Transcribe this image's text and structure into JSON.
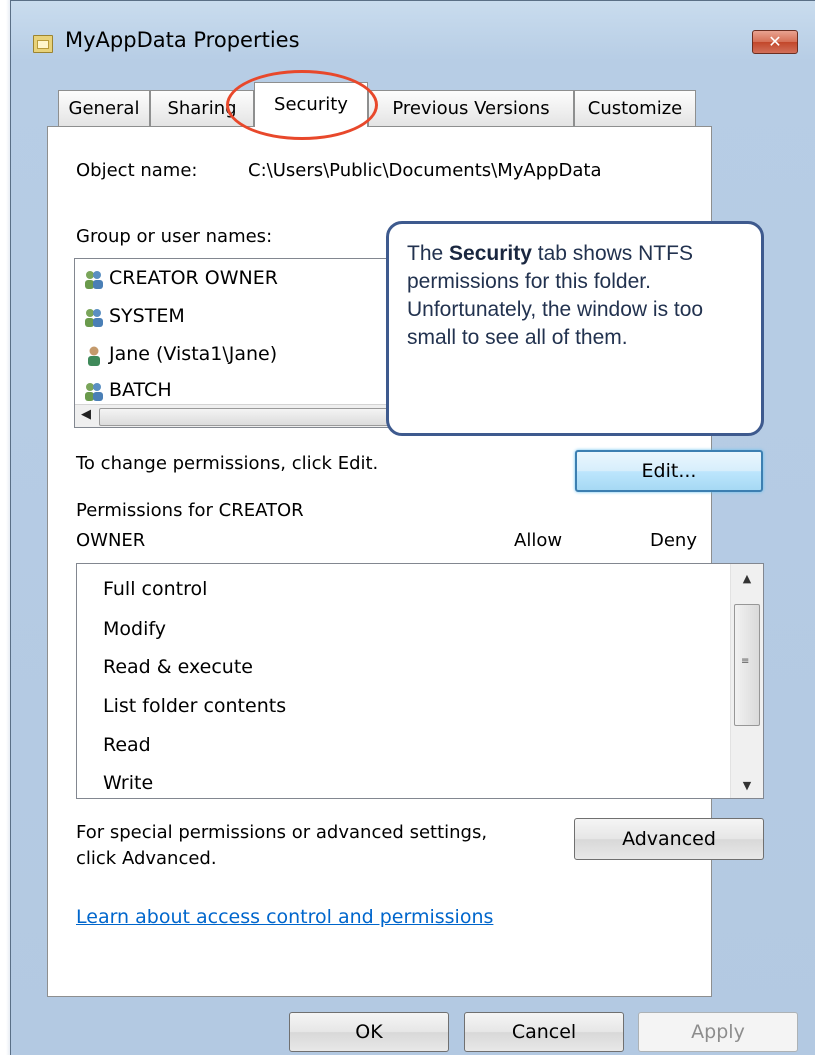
{
  "window": {
    "title": "MyAppData Properties",
    "close_label": "✕"
  },
  "tabs": [
    {
      "label": "General"
    },
    {
      "label": "Sharing"
    },
    {
      "label": "Security",
      "selected": true
    },
    {
      "label": "Previous Versions"
    },
    {
      "label": "Customize"
    }
  ],
  "object": {
    "label": "Object name:",
    "value": "C:\\Users\\Public\\Documents\\MyAppData"
  },
  "groups": {
    "label": "Group or user names:",
    "items": [
      {
        "name": "CREATOR OWNER",
        "icon": "user-group-icon"
      },
      {
        "name": "SYSTEM",
        "icon": "user-group-icon"
      },
      {
        "name": "Jane (Vista1\\Jane)",
        "icon": "user-icon"
      },
      {
        "name": "BATCH",
        "icon": "user-group-icon"
      }
    ]
  },
  "callout": {
    "lead": "The ",
    "bold": "Security",
    "rest": " tab shows NTFS permissions for this folder.  Unfortunately, the window is too small to see all of them."
  },
  "change": {
    "text": "To change permissions, click Edit.",
    "edit_label": "Edit..."
  },
  "permissions": {
    "label_line1": "Permissions for CREATOR",
    "label_line2": "OWNER",
    "allow_label": "Allow",
    "deny_label": "Deny",
    "items": [
      "Full control",
      "Modify",
      "Read & execute",
      "List folder contents",
      "Read",
      "Write"
    ]
  },
  "advanced": {
    "text_line1": "For special permissions or advanced settings,",
    "text_line2": "click Advanced.",
    "button_label": "Advanced"
  },
  "help_link": "Learn about access control and permissions",
  "footer": {
    "ok_label": "OK",
    "cancel_label": "Cancel",
    "apply_label": "Apply"
  },
  "colors": {
    "title_bg": "#b7cde5",
    "accent": "#3c7fb1",
    "link": "#0066cc",
    "highlight_ring": "#e8482b",
    "callout_border": "#3e5a8e"
  }
}
